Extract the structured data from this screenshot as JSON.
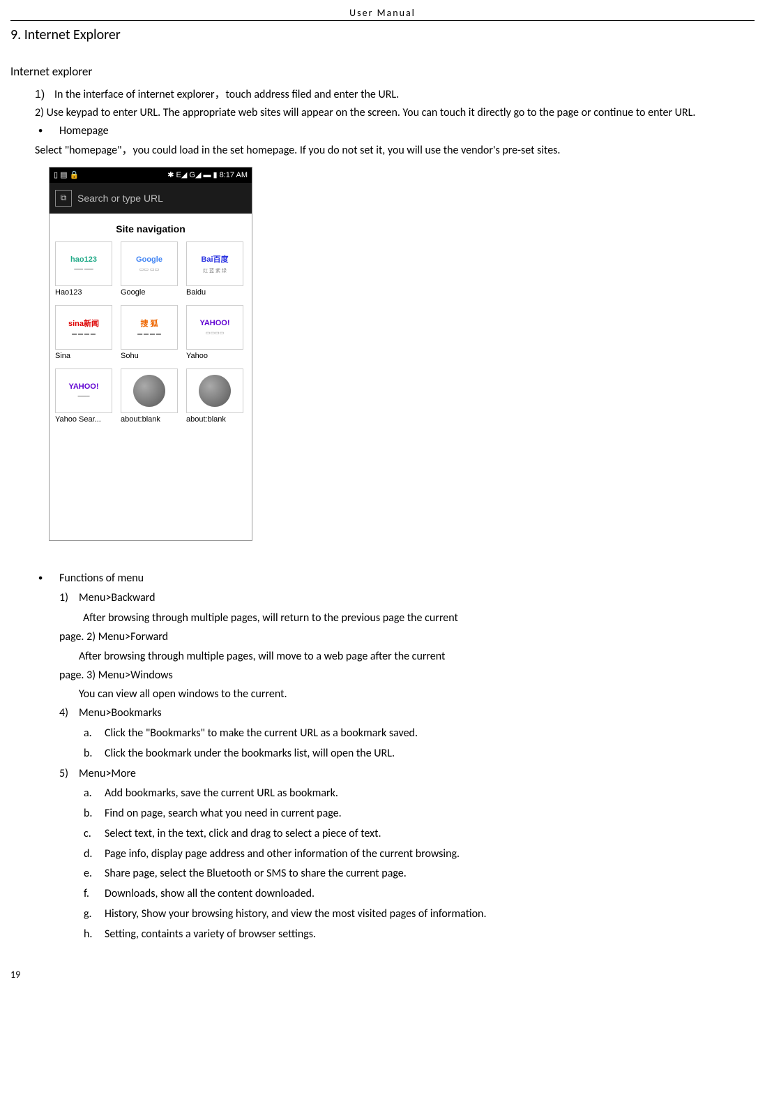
{
  "header": "User    Manual",
  "section_title": "9. Internet Explorer",
  "subtitle": "Internet explorer",
  "item1_num": "1)",
  "item1": "In the interface of internet explorer，touch address filed and enter the URL.",
  "item2": "2) Use keypad to enter URL. The appropriate web sites will appear on the screen. You can touch it directly go to the page or continue to enter URL.",
  "bullet1": "Homepage",
  "select_line": "Select \"homepage\"，you could load in the set homepage. If you do not set it, you will use the vendor's pre-set sites.",
  "phone": {
    "status_left_icons": "▯   ▤   🔒",
    "status_right": "✱  E◢ G◢ ▬ ▮ 8:17 AM",
    "url_icon": "⧉",
    "url_placeholder": "Search or type URL",
    "site_nav": "Site navigation",
    "tiles": [
      {
        "logo": "hao123",
        "color": "#2a8",
        "sub": "━━━  ━━━",
        "label": "Hao123"
      },
      {
        "logo": "Google",
        "color": "#4285f4",
        "sub": "▭▭  ▭▭",
        "label": "Google"
      },
      {
        "logo": "Bai百度",
        "color": "#2932e1",
        "sub": "红 蓝 紫 绿",
        "label": "Baidu"
      },
      {
        "logo": "sina新闻",
        "color": "#d00",
        "sub": "▬ ▬ ▬ ▬",
        "label": "Sina"
      },
      {
        "logo": "搜 狐",
        "color": "#e60",
        "sub": "▬ ▬ ▬ ▬",
        "label": "Sohu"
      },
      {
        "logo": "YAHOO!",
        "color": "#5f01d1",
        "sub": "▭▭▭▭",
        "label": "Yahoo"
      },
      {
        "logo": "YAHOO!",
        "color": "#5f01d1",
        "sub": "━━━━",
        "label": "Yahoo Sear..."
      },
      {
        "logo": "GLOBE",
        "color": "#666",
        "sub": "",
        "label": "about:blank"
      },
      {
        "logo": "GLOBE",
        "color": "#666",
        "sub": "",
        "label": "about:blank"
      }
    ]
  },
  "bullet2": "Functions of menu",
  "menu1_num": "1)",
  "menu1": "Menu>Backward",
  "menu1_desc_a": "After browsing through multiple pages, will return to the previous page the current",
  "menu1_desc_b": "page. 2) Menu>Forward",
  "menu2_desc_a": "After browsing through multiple pages, will move to a web page after the current",
  "menu2_desc_b": "page. 3) Menu>Windows",
  "menu3_desc": "You can view all open windows to the current.",
  "menu4_num": "4)",
  "menu4": "Menu>Bookmarks",
  "menu4_items": [
    {
      "l": "a.",
      "t": "Click the \"Bookmarks\" to make the current URL as a bookmark saved."
    },
    {
      "l": "b.",
      "t": "Click the bookmark under the bookmarks list, will open the URL."
    }
  ],
  "menu5_num": "5)",
  "menu5": "Menu>More",
  "menu5_items": [
    {
      "l": "a.",
      "t": "Add bookmarks, save the current URL as bookmark."
    },
    {
      "l": "b.",
      "t": "Find on page, search what you need in current page."
    },
    {
      "l": "c.",
      "t": "Select text, in the text, click and drag to select a piece of text."
    },
    {
      "l": "d.",
      "t": "Page info, display page address and other information of the current browsing."
    },
    {
      "l": "e.",
      "t": "Share page, select the Bluetooth or SMS to share the current page."
    },
    {
      "l": "f.",
      "t": "Downloads, show all the content downloaded."
    },
    {
      "l": "g.",
      "t": "History, Show your browsing history, and view the most visited pages of information."
    },
    {
      "l": "h.",
      "t": "Setting, containts a variety of browser settings."
    }
  ],
  "page_number": "19"
}
